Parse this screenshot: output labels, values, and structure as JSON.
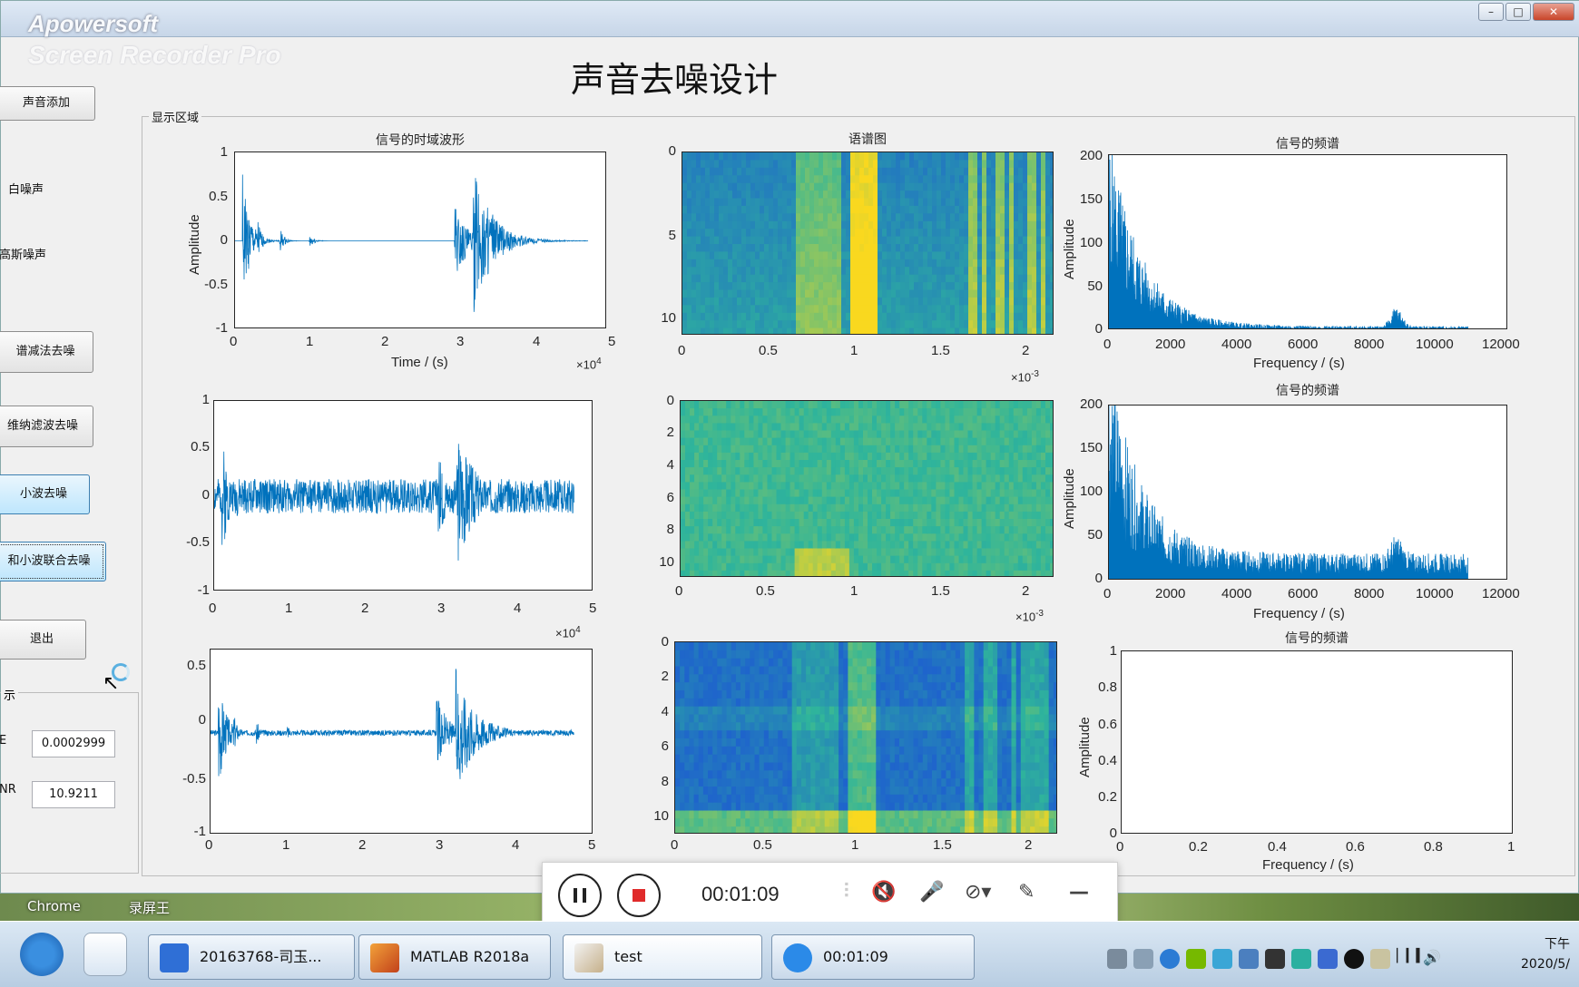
{
  "window": {
    "watermark": "Apowersoft",
    "watermark_sub": "Screen Recorder Pro",
    "controls": [
      "–",
      "□",
      "✕"
    ]
  },
  "app": {
    "title": "声音去噪设计"
  },
  "left_panel": {
    "add_button": "声音添加",
    "noise_white": "白噪声",
    "noise_gauss": "高斯噪声",
    "btn_spectral": "谱减法去噪",
    "btn_wiener": "维纳滤波去噪",
    "btn_wavelet": "小波去噪",
    "btn_combined": "和小波联合去噪",
    "btn_exit": "退出",
    "result_group": "示",
    "label_mse": "E",
    "value_mse": "0.0002999",
    "label_snr": "NR",
    "value_snr": "10.9211"
  },
  "region": {
    "label": "显示区域"
  },
  "plots": {
    "time1": {
      "title": "信号的时域波形",
      "ylabel": "Amplitude",
      "xlabel": "Time / (s)",
      "yticks": [
        "1",
        "0.5",
        "0",
        "-0.5",
        "-1"
      ],
      "xticks": [
        "0",
        "1",
        "2",
        "3",
        "4",
        "5"
      ],
      "mult": "×10",
      "mult_exp": "4"
    },
    "time2": {
      "yticks": [
        "1",
        "0.5",
        "0",
        "-0.5",
        "-1"
      ],
      "xticks": [
        "0",
        "1",
        "2",
        "3",
        "4",
        "5"
      ],
      "mult": "×10",
      "mult_exp": "4"
    },
    "time3": {
      "yticks": [
        "0.5",
        "0",
        "-0.5",
        "-1"
      ],
      "xticks": [
        "0",
        "1",
        "2",
        "3",
        "4",
        "5"
      ]
    },
    "spec1": {
      "title": "语谱图",
      "yticks": [
        "0",
        "5",
        "10"
      ],
      "xticks": [
        "0",
        "0.5",
        "1",
        "1.5",
        "2"
      ],
      "mult": "×10",
      "mult_exp": "-3"
    },
    "spec2": {
      "yticks": [
        "0",
        "2",
        "4",
        "6",
        "8",
        "10"
      ],
      "xticks": [
        "0",
        "0.5",
        "1",
        "1.5",
        "2"
      ],
      "mult": "×10",
      "mult_exp": "-3"
    },
    "spec3": {
      "yticks": [
        "0",
        "2",
        "4",
        "6",
        "8",
        "10"
      ],
      "xticks": [
        "0",
        "0.5",
        "1",
        "1.5",
        "2"
      ]
    },
    "freq1": {
      "title": "信号的频谱",
      "ylabel": "Amplitude",
      "xlabel": "Frequency / (s)",
      "yticks": [
        "200",
        "150",
        "100",
        "50",
        "0"
      ],
      "xticks": [
        "0",
        "2000",
        "4000",
        "6000",
        "8000",
        "10000",
        "12000"
      ]
    },
    "freq2": {
      "title": "信号的频谱",
      "ylabel": "Amplitude",
      "xlabel": "Frequency / (s)",
      "yticks": [
        "200",
        "150",
        "100",
        "50",
        "0"
      ],
      "xticks": [
        "0",
        "2000",
        "4000",
        "6000",
        "8000",
        "10000",
        "12000"
      ]
    },
    "freq3": {
      "title": "信号的频谱",
      "ylabel": "Amplitude",
      "xlabel": "Frequency / (s)",
      "yticks": [
        "1",
        "0.8",
        "0.6",
        "0.4",
        "0.2",
        "0"
      ],
      "xticks": [
        "0",
        "0.2",
        "0.4",
        "0.6",
        "0.8",
        "1"
      ]
    }
  },
  "recorder": {
    "time": "00:01:09"
  },
  "desktop": {
    "shortcut1": "Chrome",
    "shortcut2": "录屏王"
  },
  "taskbar": {
    "item1": "20163768-司玉...",
    "item2": "MATLAB R2018a",
    "item3": "test",
    "item4": "00:01:09",
    "clock_ampm": "下午",
    "clock_date": "2020/5/"
  },
  "colors": {
    "signal": "#0072bd",
    "spec_low": "#1a4fd8",
    "spec_mid": "#2fb59b",
    "spec_high": "#f9d81f"
  }
}
